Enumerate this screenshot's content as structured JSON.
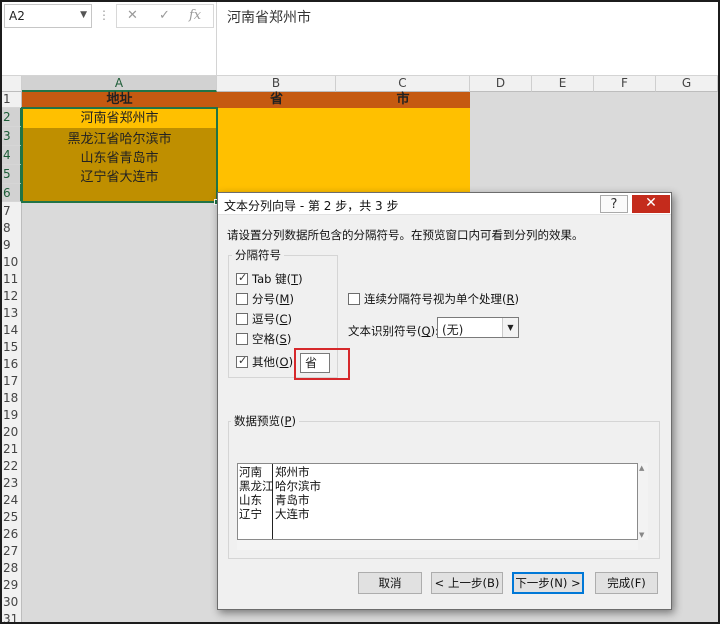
{
  "formula_bar": {
    "name_box": "A2",
    "dots": "⋮",
    "cancel_icon": "✕",
    "enter_icon": "✓",
    "fx_label": "fx",
    "content": "河南省郑州市"
  },
  "columns": [
    "A",
    "B",
    "C",
    "D",
    "E",
    "F",
    "G"
  ],
  "rows": [
    "1",
    "2",
    "3",
    "4",
    "5",
    "6",
    "7",
    "8",
    "9",
    "10",
    "11",
    "12",
    "13",
    "14",
    "15",
    "16",
    "17",
    "18",
    "19",
    "20",
    "21",
    "22",
    "23",
    "24",
    "25",
    "26",
    "27",
    "28",
    "29",
    "30",
    "31"
  ],
  "headers": {
    "a": "地址",
    "b": "省",
    "c": "市"
  },
  "cells": [
    "河南省郑州市",
    "黑龙江省哈尔滨市",
    "山东省青岛市",
    "辽宁省大连市"
  ],
  "colors": {
    "header": "#c55a11",
    "fill_gold": "#ffc000",
    "fill_dark": "#bf8f00",
    "selection": "#217346",
    "highlight": "#d6282b"
  },
  "dialog": {
    "title": "文本分列向导 - 第 2 步，共 3 步",
    "help": "?",
    "close": "✕",
    "instruction": "请设置分列数据所包含的分隔符号。在预览窗口内可看到分列的效果。",
    "delimiters_label": "分隔符号",
    "options": [
      {
        "label": "Tab 键",
        "key": "T",
        "checked": true
      },
      {
        "label": "分号",
        "key": "M",
        "checked": false
      },
      {
        "label": "逗号",
        "key": "C",
        "checked": false
      },
      {
        "label": "空格",
        "key": "S",
        "checked": false
      },
      {
        "label": "其他",
        "key": "O",
        "checked": true
      }
    ],
    "other_value": "省",
    "consecutive": {
      "label": "连续分隔符号视为单个处理",
      "key": "R",
      "checked": false
    },
    "qualifier": {
      "label": "文本识别符号",
      "key": "Q",
      "value": "(无)"
    },
    "preview_label": "数据预览",
    "preview_key": "P",
    "preview_rows": [
      [
        "河南",
        "郑州市"
      ],
      [
        "黑龙江",
        "哈尔滨市"
      ],
      [
        "山东",
        "青岛市"
      ],
      [
        "辽宁",
        "大连市"
      ]
    ],
    "buttons": {
      "cancel": "取消",
      "back": "< 上一步(B)",
      "next": "下一步(N) >",
      "finish": "完成(F)"
    }
  }
}
